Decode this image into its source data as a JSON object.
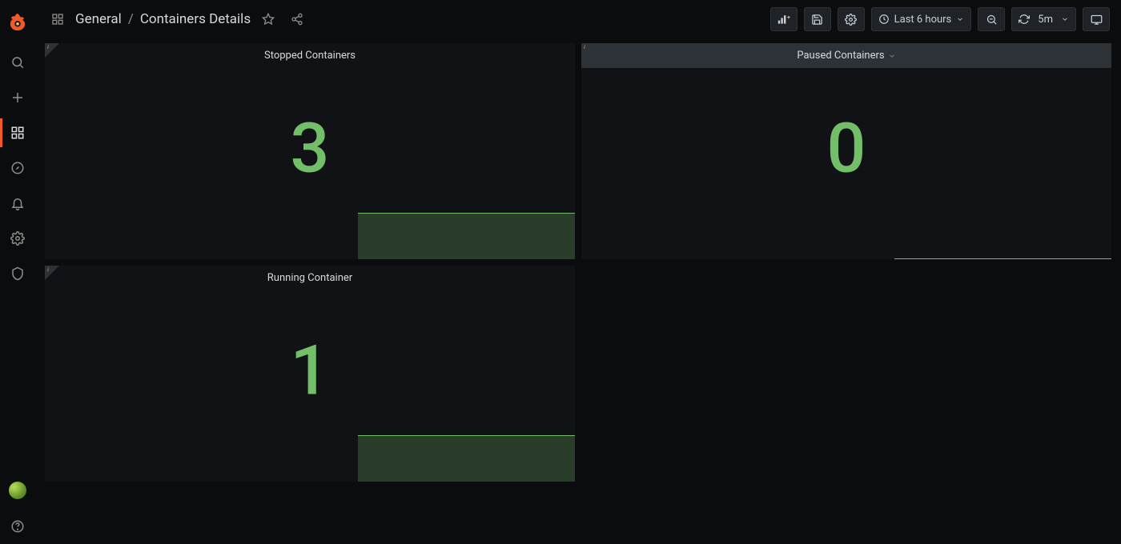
{
  "breadcrumb": {
    "folder": "General",
    "dashboard": "Containers Details"
  },
  "toolbar": {
    "timerange": "Last 6 hours",
    "refresh_interval": "5m"
  },
  "panels": {
    "stopped": {
      "title": "Stopped Containers",
      "value": "3"
    },
    "paused": {
      "title": "Paused Containers",
      "value": "0"
    },
    "running": {
      "title": "Running Container",
      "value": "1"
    }
  },
  "colors": {
    "accent": "#f05a28",
    "value_green": "#73bf69"
  }
}
